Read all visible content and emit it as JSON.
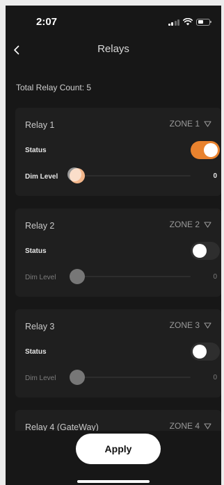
{
  "status_bar": {
    "time": "2:07",
    "icons": [
      "signal-icon",
      "wifi-icon",
      "battery-icon"
    ]
  },
  "nav": {
    "back_icon": "chevron-left-icon",
    "title": "Relays"
  },
  "total_relay_count": "Total Relay Count: 5",
  "relays": [
    {
      "name": "Relay 1",
      "zone": "ZONE 1",
      "status_label": "Status",
      "status_on": true,
      "dim_label": "Dim Level",
      "dim_value": "0",
      "dim_enabled": true
    },
    {
      "name": "Relay 2",
      "zone": "ZONE 2",
      "status_label": "Status",
      "status_on": false,
      "dim_label": "Dim Level",
      "dim_value": "0",
      "dim_enabled": false
    },
    {
      "name": "Relay 3",
      "zone": "ZONE 3",
      "status_label": "Status",
      "status_on": false,
      "dim_label": "Dim Level",
      "dim_value": "0",
      "dim_enabled": false
    },
    {
      "name": "Relay 4 (GateWay)",
      "zone": "ZONE 4"
    }
  ],
  "apply_label": "Apply",
  "colors": {
    "background": "#171717",
    "card": "#1f1f1f",
    "accent": "#e8822e",
    "text": "#d6d6d6",
    "muted": "#7d7d7d"
  }
}
